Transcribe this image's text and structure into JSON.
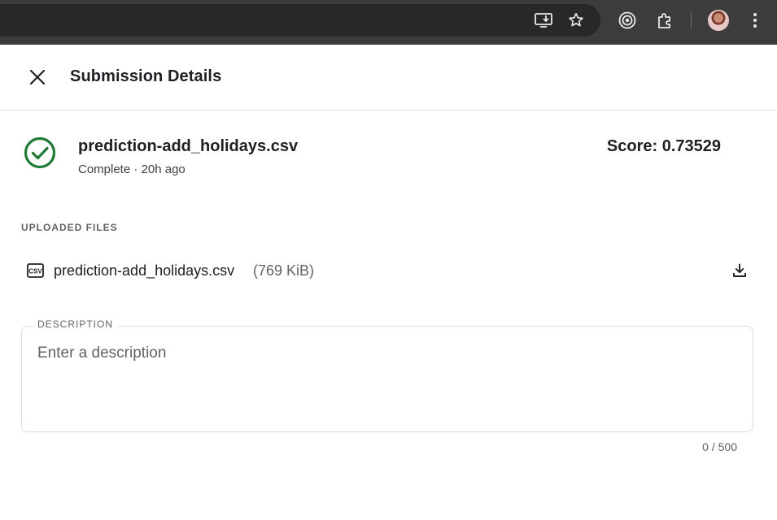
{
  "browser": {
    "toolbar_icons": [
      "install-app-icon",
      "bookmark-star-icon",
      "media-icon",
      "extensions-icon",
      "profile-avatar",
      "more-menu-icon"
    ]
  },
  "dialog": {
    "title": "Submission Details",
    "close_icon": "close-icon"
  },
  "submission": {
    "file_name": "prediction-add_holidays.csv",
    "meta": "Complete · 20h ago",
    "score": "Score: 0.73529",
    "status_icon": "check-circle-icon",
    "status_color": "#1e7a34"
  },
  "uploaded_files": {
    "heading": "UPLOADED FILES",
    "files": [
      {
        "name": "prediction-add_holidays.csv",
        "size": "(769 KiB)",
        "icon": "csv-file-icon",
        "action_icon": "download-icon"
      }
    ]
  },
  "description": {
    "label": "DESCRIPTION",
    "value": "",
    "placeholder": "Enter a description",
    "counter": "0 / 500"
  }
}
